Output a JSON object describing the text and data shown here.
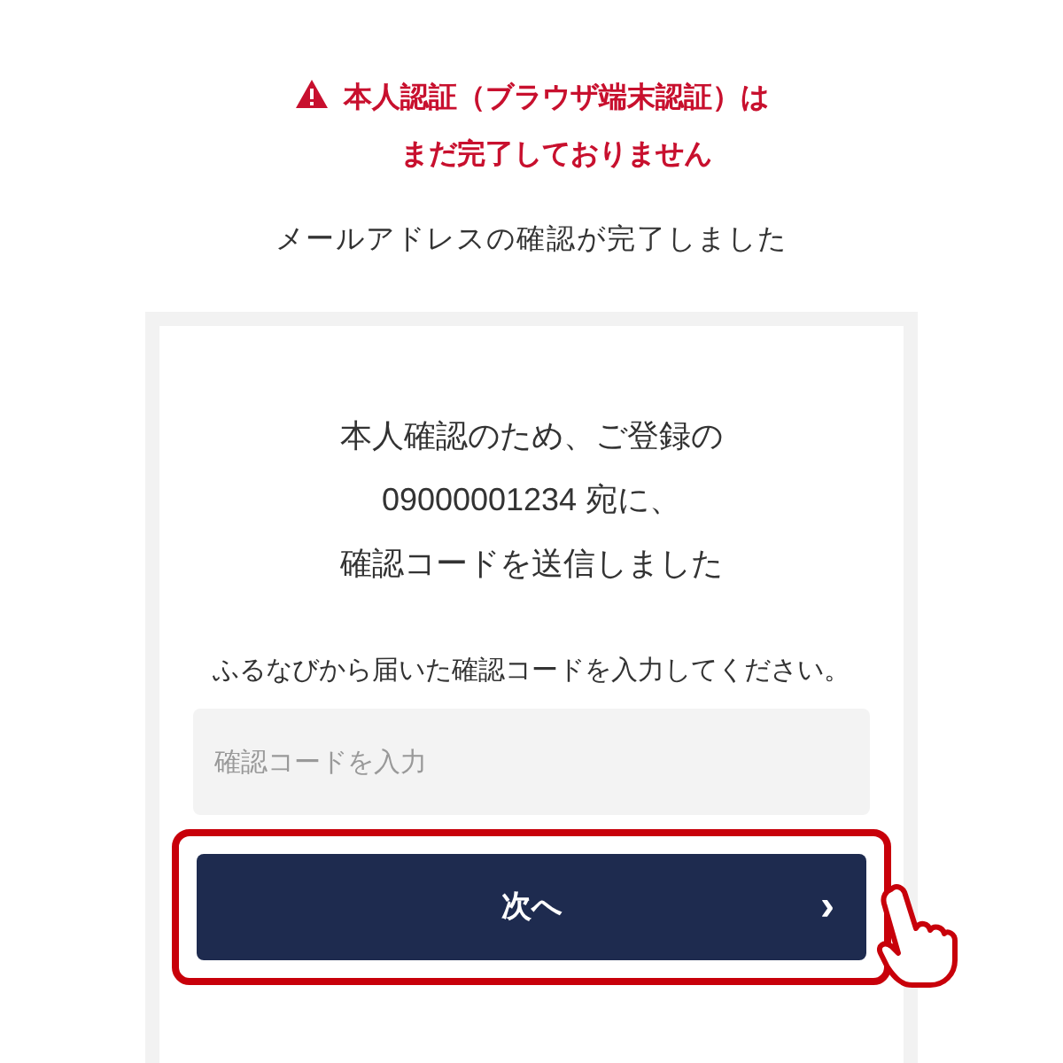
{
  "warning": {
    "lines": [
      "本人認証（ブラウザ端末認証）は",
      "まだ完了しておりません"
    ]
  },
  "status": "メールアドレスの確認が完了しました",
  "card": {
    "message_lines": [
      "本人確認のため、ご登録の",
      "09000001234 宛に、",
      "確認コードを送信しました"
    ],
    "instruction": "ふるなびから届いた確認コードを入力してください。",
    "code_field": {
      "placeholder": "確認コードを入力"
    },
    "next_button": {
      "label": "次へ",
      "chevron": "›",
      "highlighted": true
    }
  }
}
